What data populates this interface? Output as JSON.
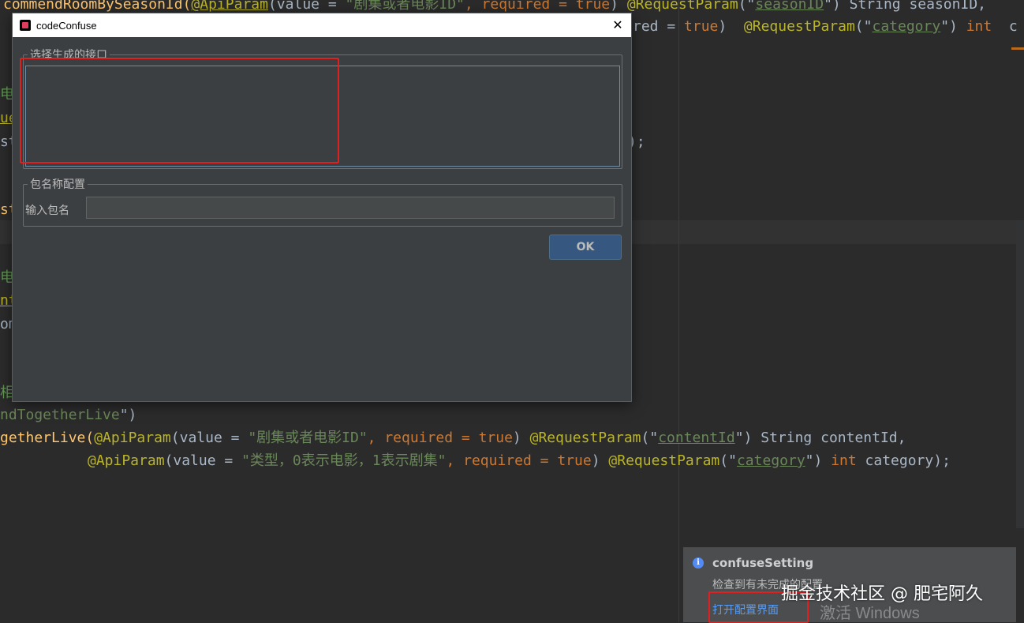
{
  "editor": {
    "lines": {
      "l1a": "commendRoomBySeasonId(",
      "l1b": "@ApiParam",
      "l1c": "(value = ",
      "l1d": "\"剧集或者电影ID\"",
      "l1e": ", required = ",
      "l1f": "true",
      "l1g": ") ",
      "l1h": "@RequestParam",
      "l1i": "(\"",
      "l1j": "seasonID",
      "l1k": "\") String seasonID,",
      "l2a": "red = ",
      "l2b": "true",
      "l2c": ")  ",
      "l2d": "@RequestParam",
      "l2e": "(\"",
      "l2f": "category",
      "l2g": "\") ",
      "l2h": "int",
      "l2i": "  c",
      "l3": "电",
      "l4": "ue",
      "l5": "st",
      "l5b": ");",
      "l6": "st",
      "l7": "电",
      "l8": "nt",
      "l9": "om",
      "l10": "相",
      "l11a": "ndTogetherLive",
      "l11b": "\")",
      "l12a": "getherLive(",
      "l12b": "@ApiParam",
      "l12c": "(value = ",
      "l12d": "\"剧集或者电影ID\"",
      "l12e": ", required = ",
      "l12f": "true",
      "l12g": ") ",
      "l12h": "@RequestParam",
      "l12i": "(\"",
      "l12j": "contentId",
      "l12k": "\") String contentId,",
      "l13a": "@ApiParam",
      "l13b": "(value = ",
      "l13c": "\"类型，0表示电影，1表示剧集\"",
      "l13d": ", required = ",
      "l13e": "true",
      "l13f": ") ",
      "l13g": "@RequestParam",
      "l13h": "(\"",
      "l13i": "category",
      "l13j": "\") ",
      "l13k": "int",
      "l13l": " category);"
    }
  },
  "dialog": {
    "title": "codeConfuse",
    "close_glyph": "✕",
    "interfaces_group_label": "选择生成的接口",
    "package_group_label": "包名称配置",
    "package_input_label": "输入包名",
    "package_input_value": "",
    "ok_label": "OK"
  },
  "notification": {
    "title": "confuseSetting",
    "message": "检查到有未完成的配置",
    "link": "打开配置界面",
    "icon": "info-icon"
  },
  "overlay": {
    "activate_windows": "激活 Windows",
    "watermark": "掘金技术社区 @ 肥宅阿久"
  },
  "colors": {
    "highlight_box": "#e02020",
    "link": "#589df6",
    "ok_button": "#365880"
  }
}
